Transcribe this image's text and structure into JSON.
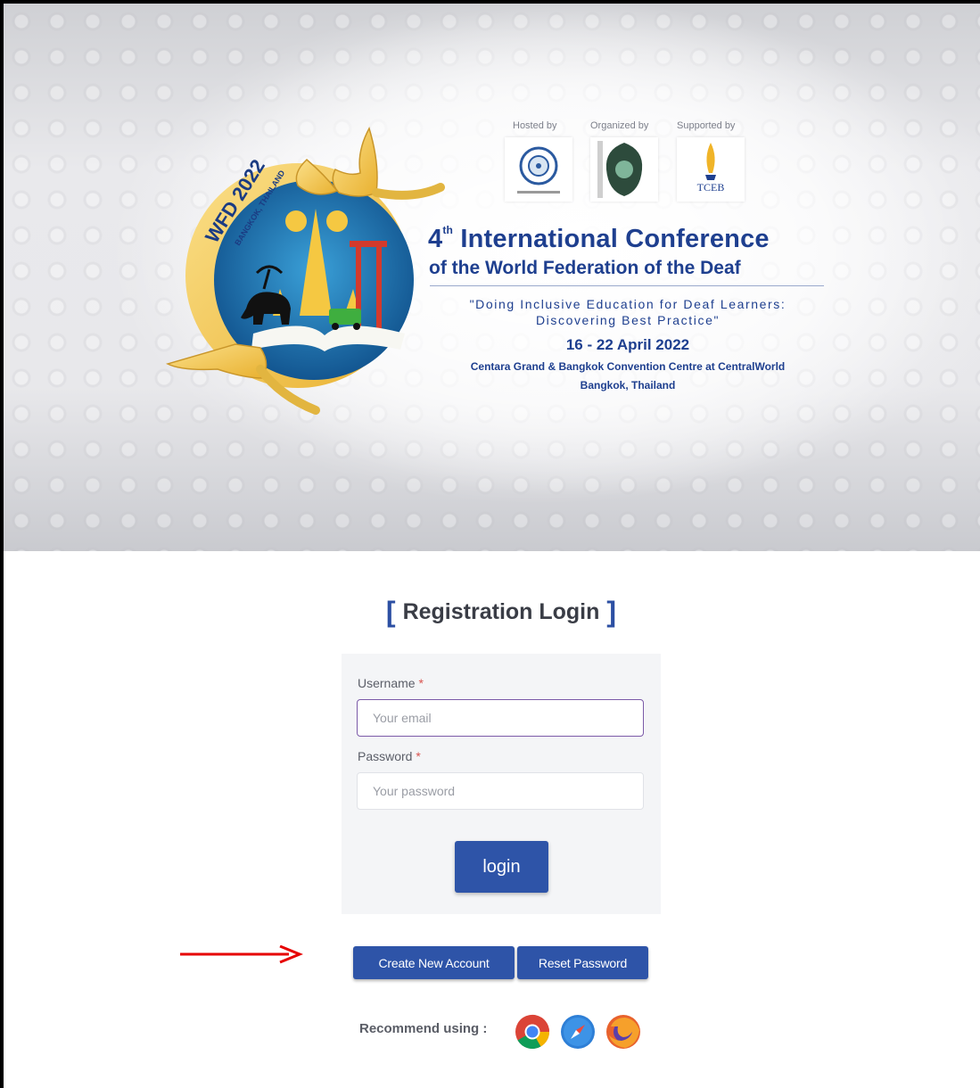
{
  "banner": {
    "sponsors": [
      {
        "label": "Hosted by"
      },
      {
        "label": "Organized by"
      },
      {
        "label": "Supported by",
        "logo_text": "TCEB"
      }
    ],
    "logo_ring_text": {
      "line1": "WFD 2022",
      "line2": "BANGKOK, THAILAND"
    },
    "title_ordinal": "4",
    "title_sup": "th",
    "title_rest": " International Conference",
    "subtitle": "of the World Federation of the Deaf",
    "quote_line1": "\"Doing Inclusive Education for Deaf Learners:",
    "quote_line2": "Discovering Best Practice\"",
    "date": "16 - 22 April 2022",
    "venue": "Centara Grand & Bangkok Convention Centre at CentralWorld",
    "city": "Bangkok, Thailand",
    "colors": {
      "navy": "#1e3f8f",
      "gold": "#f2c94c",
      "blue_globe": "#1f6fb0"
    }
  },
  "login": {
    "bracket_open": "[",
    "title": "Registration Login",
    "bracket_close": "]",
    "username_label": "Username",
    "username_placeholder": "Your email",
    "password_label": "Password",
    "password_placeholder": "Your password",
    "required_mark": "*",
    "login_button": "login"
  },
  "actions": {
    "create_account": "Create New Account",
    "reset_password": "Reset Password"
  },
  "recommend": {
    "label": "Recommend using :",
    "browsers": [
      "chrome-icon",
      "safari-icon",
      "firefox-icon"
    ]
  },
  "colors": {
    "button": "#2e54a8",
    "annotation_arrow": "#e60000"
  }
}
